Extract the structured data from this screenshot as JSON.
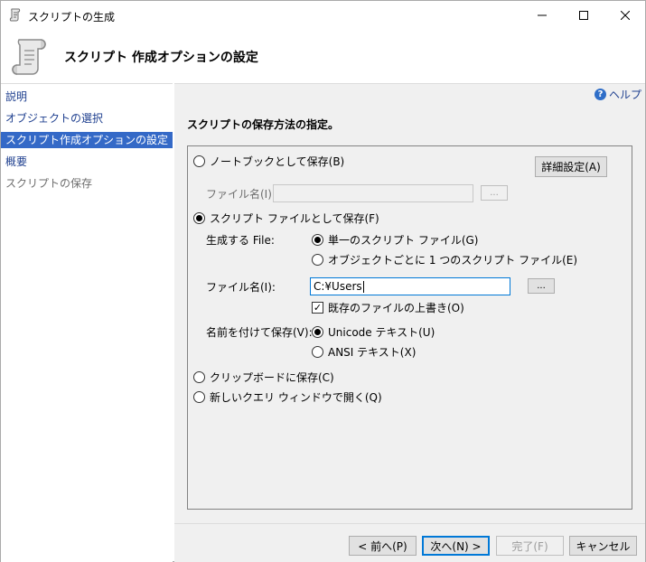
{
  "window": {
    "title": "スクリプトの生成",
    "icon": "scroll-icon"
  },
  "header": {
    "title": "スクリプト 作成オプションの設定",
    "icon": "scroll-icon"
  },
  "sidebar": {
    "items": [
      {
        "label": "説明",
        "state": "link"
      },
      {
        "label": "オブジェクトの選択",
        "state": "link"
      },
      {
        "label": "スクリプト作成オプションの設定",
        "state": "active"
      },
      {
        "label": "概要",
        "state": "link"
      },
      {
        "label": "スクリプトの保存",
        "state": "disabled"
      }
    ]
  },
  "main": {
    "help_label": "ヘルプ",
    "section_title": "スクリプトの保存方法の指定。",
    "options": {
      "notebook_label": "ノートブックとして保存(B)",
      "advanced_button": "詳細設定(A)",
      "notebook_filename_label": "ファイル名(I):",
      "notebook_filename_value": "",
      "browse_label": "...",
      "script_file_label": "スクリプト ファイルとして保存(F)",
      "generate_file_label": "生成する File:",
      "single_file_label": "単一のスクリプト ファイル(G)",
      "per_object_label": "オブジェクトごとに 1 つのスクリプト ファイル(E)",
      "filename_label": "ファイル名(I):",
      "filename_value": "C:¥Users",
      "overwrite_label": "既存のファイルの上書き(O)",
      "save_as_label": "名前を付けて保存(V):",
      "unicode_label": "Unicode テキスト(U)",
      "ansi_label": "ANSI テキスト(X)",
      "clipboard_label": "クリップボードに保存(C)",
      "query_window_label": "新しいクエリ ウィンドウで開く(Q)"
    }
  },
  "footer": {
    "prev": "< 前へ(P)",
    "next": "次へ(N) >",
    "finish": "完了(F)",
    "cancel": "キャンセル"
  },
  "colors": {
    "accent": "#3469c7",
    "link": "#1e3f8f"
  }
}
